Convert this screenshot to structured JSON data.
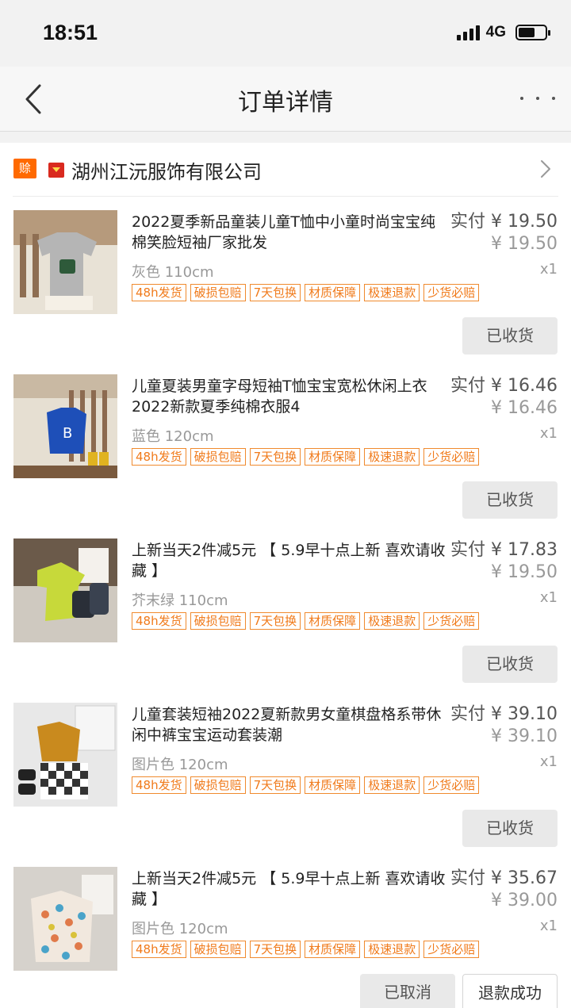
{
  "status_bar": {
    "time": "18:51",
    "network": "4G"
  },
  "nav": {
    "title": "订单详情"
  },
  "shop": {
    "badge": "赊",
    "name": "湖州江沅服饰有限公司"
  },
  "items": [
    {
      "title": "2022夏季新品童装儿童T恤中小童时尚宝宝纯棉笑脸短袖厂家批发",
      "paid": "实付 ¥ 19.50",
      "original": "¥ 19.50",
      "variant": "灰色 110cm",
      "qty": "x1",
      "tags": [
        "48h发货",
        "破损包赔",
        "7天包换",
        "材质保障",
        "极速退款",
        "少货必赔"
      ],
      "buttons": [
        "已收货"
      ],
      "image_palette": [
        "#9b7b5f",
        "#b5b5b5",
        "#e8e2d6"
      ]
    },
    {
      "title": "儿童夏装男童字母短袖T恤宝宝宽松休闲上衣2022新款夏季纯棉衣服4",
      "paid": "实付 ¥ 16.46",
      "original": "¥ 16.46",
      "variant": "蓝色 120cm",
      "qty": "x1",
      "tags": [
        "48h发货",
        "破损包赔",
        "7天包换",
        "材质保障",
        "极速退款",
        "少货必赔"
      ],
      "buttons": [
        "已收货"
      ],
      "image_palette": [
        "#8c6a50",
        "#1e4fb8",
        "#e6dfd2"
      ]
    },
    {
      "title": "上新当天2件减5元 【 5.9早十点上新 喜欢请收藏 】",
      "paid": "实付 ¥ 17.83",
      "original": "¥ 19.50",
      "variant": "芥末绿 110cm",
      "qty": "x1",
      "tags": [
        "48h发货",
        "破损包赔",
        "7天包换",
        "材质保障",
        "极速退款",
        "少货必赔"
      ],
      "buttons": [
        "已收货"
      ],
      "image_palette": [
        "#6b5a4a",
        "#c7d93a",
        "#cfc9c0"
      ]
    },
    {
      "title": "儿童套装短袖2022夏新款男女童棋盘格系带休闲中裤宝宝运动套装潮",
      "paid": "实付 ¥ 39.10",
      "original": "¥ 39.10",
      "variant": "图片色 120cm",
      "qty": "x1",
      "tags": [
        "48h发货",
        "破损包赔",
        "7天包换",
        "材质保障",
        "极速退款",
        "少货必赔"
      ],
      "buttons": [
        "已收货"
      ],
      "image_palette": [
        "#e8e8e8",
        "#c98a1e",
        "#333333"
      ]
    },
    {
      "title": "上新当天2件减5元 【 5.9早十点上新 喜欢请收藏 】",
      "paid": "实付 ¥ 35.67",
      "original": "¥ 39.00",
      "variant": "图片色 120cm",
      "qty": "x1",
      "tags": [
        "48h发货",
        "破损包赔",
        "7天包换",
        "材质保障",
        "极速退款",
        "少货必赔"
      ],
      "buttons": [
        "已取消",
        "退款成功"
      ],
      "image_palette": [
        "#d6d2cc",
        "#e07a4a",
        "#4aa3c9"
      ]
    }
  ]
}
